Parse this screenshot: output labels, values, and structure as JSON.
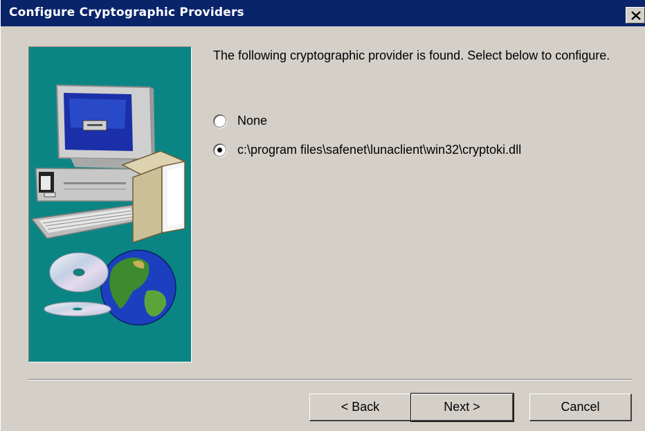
{
  "window": {
    "title": "Configure Cryptographic Providers",
    "close_glyph": "✕"
  },
  "side_panel": {
    "image": "computer-globe-cd-illustration",
    "background": "#0b8584"
  },
  "content": {
    "intro": "The following cryptographic provider is found.  Select below to configure.",
    "options": [
      {
        "label": "None",
        "selected": false
      },
      {
        "label": "c:\\program files\\safenet\\lunaclient\\win32\\cryptoki.dll",
        "selected": true
      }
    ]
  },
  "buttons": {
    "back": "< Back",
    "next": "Next >",
    "cancel": "Cancel"
  },
  "colors": {
    "titlebar": "#0a246a",
    "face": "#d4d0c8"
  }
}
